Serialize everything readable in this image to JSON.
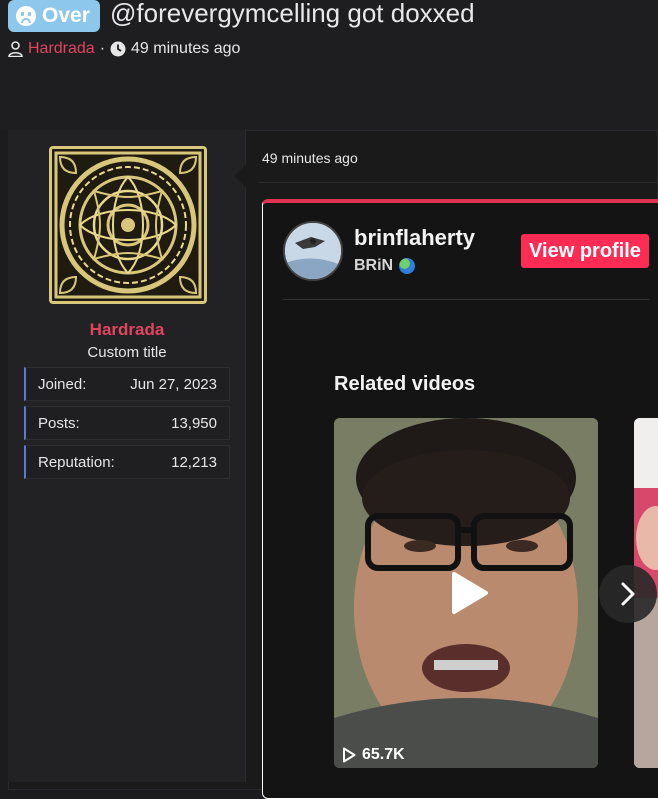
{
  "thread": {
    "prefix_label": "Over",
    "title": "@forevergymcelling got doxxed",
    "author": "Hardrada",
    "separator": "·",
    "time_ago": "49 minutes ago"
  },
  "post": {
    "time_ago": "49 minutes ago",
    "user": {
      "name": "Hardrada",
      "custom_title": "Custom title",
      "stats": [
        {
          "label": "Joined:",
          "value": "Jun 27, 2023"
        },
        {
          "label": "Posts:",
          "value": "13,950"
        },
        {
          "label": "Reputation:",
          "value": "12,213"
        }
      ]
    }
  },
  "embed": {
    "handle": "brinflaherty",
    "nickname": "BRiN",
    "view_profile_label": "View profile",
    "related_heading": "Related videos",
    "video1_views": "65.7K"
  },
  "colors": {
    "accent": "#e0455e",
    "prefix_bg": "#8ec7ec",
    "tiktok_red": "#fe2c55",
    "stat_border": "#5c7bd0"
  }
}
